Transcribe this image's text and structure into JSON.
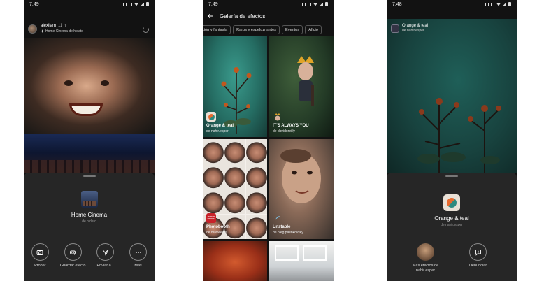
{
  "phone1": {
    "status": {
      "time": "7:49"
    },
    "story": {
      "username": "alexliam",
      "time": "11 h",
      "effect_link": "Home Cinema de hidato"
    },
    "sheet": {
      "effect_name": "Home Cinema",
      "effect_author": "de hidato",
      "actions": [
        {
          "label": "Probar",
          "icon": "camera-icon"
        },
        {
          "label": "Guardar efecto",
          "icon": "save-effect-icon"
        },
        {
          "label": "Enviar a...",
          "icon": "send-icon"
        },
        {
          "label": "Más",
          "icon": "more-icon"
        }
      ]
    }
  },
  "phone2": {
    "status": {
      "time": "7:49"
    },
    "title": "Galería de efectos",
    "chips": [
      "ción y fantasía",
      "Raros y espeluznantes",
      "Eventos",
      "Aficio"
    ],
    "tiles": [
      {
        "name": "Orange & teal",
        "author": "de nahir.esper"
      },
      {
        "name": "IT'S ALWAYS YOU",
        "author": "de davidoreilly"
      },
      {
        "name": "Photobooth",
        "author": "de maxwelsel",
        "icon_text": "PHOTO BOOTH"
      },
      {
        "name": "Unstable",
        "author": "de oleg.pashkovsky"
      }
    ]
  },
  "phone3": {
    "status": {
      "time": "7:48"
    },
    "header": {
      "title": "Orange & teal",
      "subtitle": "de nahir.esper"
    },
    "sheet": {
      "effect_name": "Orange & teal",
      "effect_author": "de nahir.esper",
      "actions": [
        {
          "label": "Más efectos de nahir.esper",
          "icon": "author-avatar"
        },
        {
          "label": "Denunciar",
          "icon": "report-icon"
        }
      ]
    }
  },
  "colors": {
    "sheet_bg": "#262626",
    "teal": "#2e8a80",
    "orange": "#e86a2e"
  }
}
